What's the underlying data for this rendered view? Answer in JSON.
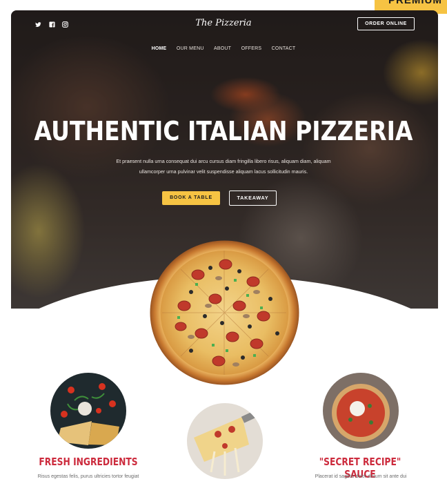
{
  "ribbon": {
    "label": "PREMIUM"
  },
  "header": {
    "brand": "The Pizzeria",
    "order_button": "ORDER ONLINE",
    "social_icons": [
      "twitter-icon",
      "facebook-icon",
      "instagram-icon"
    ]
  },
  "nav": {
    "items": [
      "HOME",
      "OUR MENU",
      "ABOUT",
      "OFFERS",
      "CONTACT"
    ],
    "active": "HOME"
  },
  "hero": {
    "title": "AUTHENTIC ITALIAN PIZZERIA",
    "subtitle": "Et praesent nulla urna consequat dui arcu cursus diam fringilla libero risus, aliquam diam, aliquam ullamcorper urna pulvinar velit suspendisse aliquam lacus sollicitudin mauris.",
    "book_button": "BOOK A TABLE",
    "takeaway_button": "TAKEAWAY"
  },
  "features": [
    {
      "title": "FRESH INGREDIENTS",
      "text": "Risus egestas felis, purus ultricies tortor feugiat"
    },
    {
      "title": "\"SECRET RECIPE\" SAUCE",
      "text": "Placerat id sagittis dolor dictum sit ante dui"
    }
  ],
  "colors": {
    "accent": "#f6c343",
    "feature_title": "#cc2a3c"
  }
}
